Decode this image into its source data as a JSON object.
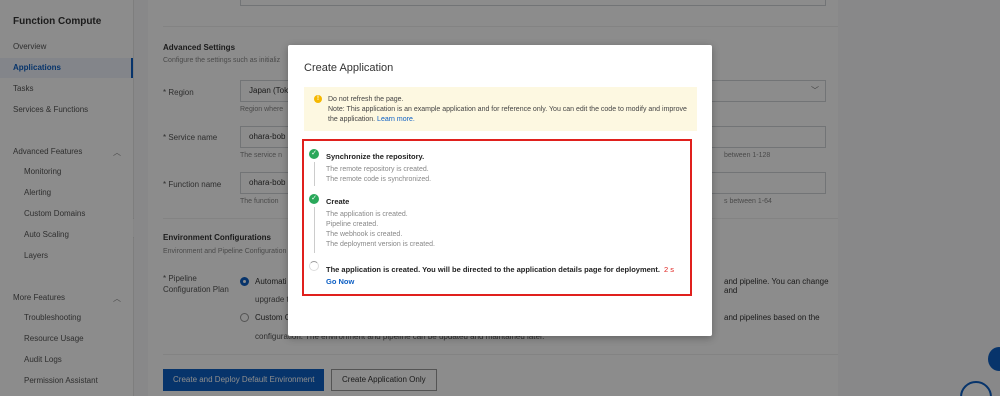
{
  "sidebar": {
    "title": "Function Compute",
    "items": [
      {
        "label": "Overview"
      },
      {
        "label": "Applications"
      },
      {
        "label": "Tasks"
      },
      {
        "label": "Services & Functions"
      }
    ],
    "advanced_group": "Advanced Features",
    "advanced_items": [
      {
        "label": "Monitoring"
      },
      {
        "label": "Alerting"
      },
      {
        "label": "Custom Domains"
      },
      {
        "label": "Auto Scaling"
      },
      {
        "label": "Layers"
      }
    ],
    "more_group": "More Features",
    "more_items": [
      {
        "label": "Troubleshooting"
      },
      {
        "label": "Resource Usage"
      },
      {
        "label": "Audit Logs"
      },
      {
        "label": "Permission Assistant"
      }
    ]
  },
  "form": {
    "advanced_title": "Advanced Settings",
    "advanced_desc": "Configure the settings such as initializ",
    "region_label": "* Region",
    "region_value": "Japan (Toky",
    "region_hint": "Region where",
    "service_label": "* Service name",
    "service_value": "ohara-bob",
    "service_hint_left": "The service n",
    "service_hint_right": "between 1-128",
    "function_label": "* Function name",
    "function_value": "ohara-bob",
    "function_hint_left": "The function",
    "function_hint_right": "s between 1-64",
    "env_title": "Environment Configurations",
    "env_desc": "Environment and Pipeline Configuration",
    "pipeline_label_1": "* Pipeline",
    "pipeline_label_2": "Configuration Plan",
    "auto_option": "Automati",
    "auto_right": "and pipeline. You can change and",
    "auto_line2": "upgrade the c",
    "custom_option": "Custom C",
    "custom_right": "and pipelines based on the",
    "custom_line2": "configuration. The environment and pipeline can be updated and maintained later.",
    "primary_button": "Create and Deploy Default Environment",
    "secondary_button": "Create Application Only"
  },
  "modal": {
    "title": "Create Application",
    "alert_title": "Do not refresh the page.",
    "alert_text": "Note: This application is an example application and for reference only. You can edit the code to modify and improve the application.",
    "alert_link": "Learn more.",
    "step1_title": "Synchronize the repository.",
    "step1_lines": [
      "The remote repository is created.",
      "The remote code is synchronized."
    ],
    "step2_title": "Create",
    "step2_lines": [
      "The application is created.",
      "Pipeline created.",
      "The webhook is created.",
      "The deployment version is created."
    ],
    "step3_title": "The application is created. You will be directed to the application details page for deployment.",
    "step3_countdown": "2 s",
    "go_now": "Go Now"
  },
  "colors": {
    "accent": "#0d5fc4",
    "success": "#2aa85a",
    "highlight_border": "#e0201d",
    "alert_bg": "#fdf8e1"
  }
}
